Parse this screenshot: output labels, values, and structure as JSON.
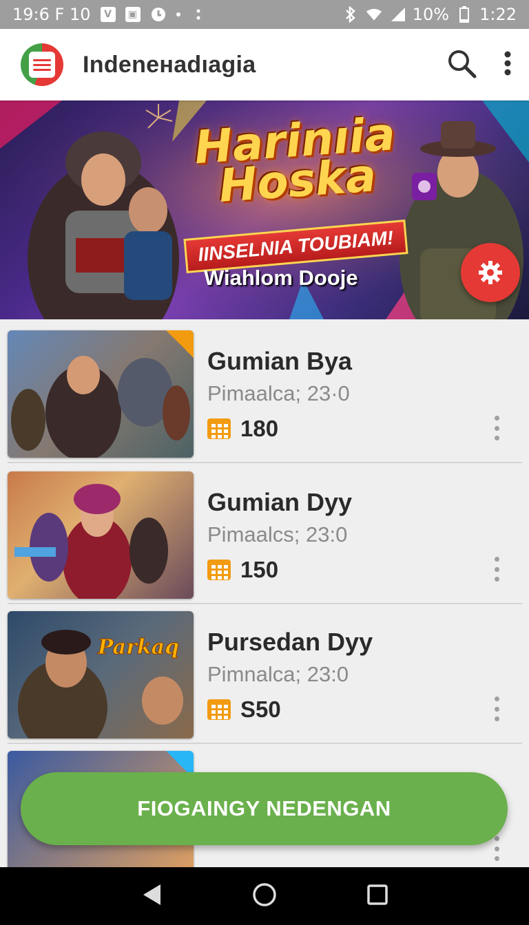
{
  "status_bar": {
    "time_left": "19:6 F 10",
    "battery": "10%",
    "clock": "1:22"
  },
  "app_bar": {
    "title": "Indeneнadıagia",
    "search_icon": "search-icon",
    "menu_icon": "more-vert-icon"
  },
  "hero": {
    "title_line1": "Harinıia",
    "title_line2": "Hoska",
    "banner": "IINSELNIA TOUBIAM!",
    "subtitle": "Wiahlom Dooje",
    "fab_icon": "settings-gear-icon"
  },
  "items": [
    {
      "title": "Gumian Bya",
      "subtitle": "Pimaalca; 23·0",
      "price": "180"
    },
    {
      "title": "Gumian Dyy",
      "subtitle": "Pimaalcs; 23:0",
      "price": "150"
    },
    {
      "title": "Pursedan Dyy",
      "subtitle": "Pimnalca; 23:0",
      "price": "S50"
    }
  ],
  "cta": {
    "label": "FIOGAINGY NEDENGAN"
  },
  "colors": {
    "accent_green": "#6ab04c",
    "fab_red": "#e53935",
    "price_icon": "#f29b11"
  }
}
